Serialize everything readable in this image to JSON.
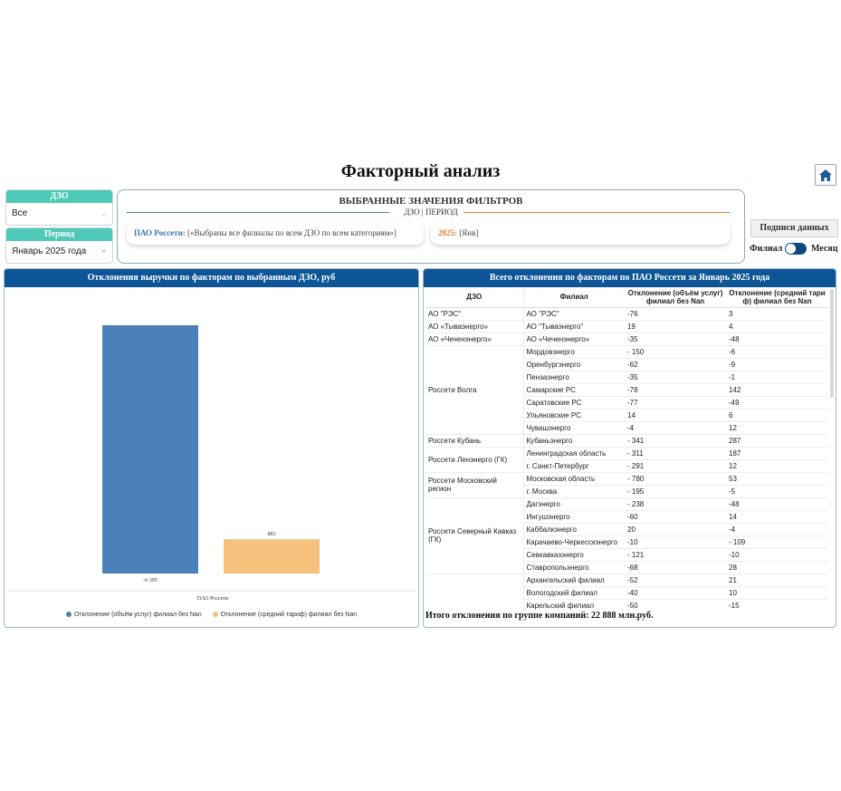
{
  "page": {
    "title": "Факторный анализ"
  },
  "icons": {
    "home": "home-icon"
  },
  "filters": {
    "dzo": {
      "label": "ДЗО",
      "value": "Все"
    },
    "period": {
      "label": "Период",
      "value": "Январь 2025 года"
    }
  },
  "selected": {
    "title": "ВЫБРАННЫЕ ЗНАЧЕНИЯ ФИЛЬТРОВ",
    "subtitle": "ДЗО | ПЕРИОД",
    "dzo_label": "ПАО Россети:",
    "dzo_value": "[«Выбраны все филиалы по всем ДЗО по всем категориям»]",
    "period_label": "2025:",
    "period_value": "[Янв]"
  },
  "controls": {
    "data_labels_button": "Подписи данных",
    "toggle_left": "Филиал",
    "toggle_right": "Месяц"
  },
  "colors": {
    "header_blue": "#0d5596",
    "filter_teal": "#4fc9b7",
    "series1": "#4c80b9",
    "series2": "#f5c17d"
  },
  "left_panel": {
    "title": "Отклонения выручки по факторам по выбранным ДЗО, руб"
  },
  "chart_data": {
    "type": "bar",
    "categories": [
      "ПАО Россети"
    ],
    "series": [
      {
        "name": "Отклонение (объём услуг) филиал без Nan",
        "values": [
          -6395
        ],
        "data_label": "-6 395"
      },
      {
        "name": "Отклонение (средний тариф) филиал без Nan",
        "values": [
          883
        ],
        "data_label": "883"
      }
    ],
    "xlabel": "ПАО Россети",
    "legend": "bottom",
    "grid": false
  },
  "right_panel": {
    "title": "Всего отклонения по факторам по ПАО Россети за Январь 2025 года",
    "columns": [
      "ДЗО",
      "Филиал",
      "Отклонение (объём услуг) филиал без Nan",
      "Отклонение (средний тари ф) филиал без Nan"
    ],
    "groups": [
      {
        "dzo": "АО \"РЭС\"",
        "rows": [
          [
            "АО \"РЭС\"",
            "-76",
            "3"
          ]
        ]
      },
      {
        "dzo": "АО «Тываэнерго»",
        "rows": [
          [
            "АО \"Тываэнерго\"",
            "19",
            "4"
          ]
        ]
      },
      {
        "dzo": "АО «Чеченэнерго»",
        "rows": [
          [
            "АО «Чеченэнерго»",
            "-35",
            "-48"
          ]
        ]
      },
      {
        "dzo": "Россети Волга",
        "rows": [
          [
            "Мордовэнерго",
            "- 150",
            "-6"
          ],
          [
            "Оренбургэнерго",
            "-62",
            "-9"
          ],
          [
            "Пензаэнерго",
            "-35",
            "-1"
          ],
          [
            "Самарские РС",
            "-78",
            "142"
          ],
          [
            "Саратовские РС",
            "-77",
            "-49"
          ],
          [
            "Ульяновские РС",
            "14",
            "6"
          ],
          [
            "Чувашэнерго",
            "-4",
            "12"
          ]
        ]
      },
      {
        "dzo": "Россети Кубань",
        "rows": [
          [
            "Кубаньэнерго",
            "- 341",
            "287"
          ]
        ]
      },
      {
        "dzo": "Россети Ленэнерго (ГК)",
        "rows": [
          [
            "Ленинградская область",
            "- 311",
            "187"
          ],
          [
            "г. Санкт-Петербург",
            "- 291",
            "12"
          ]
        ]
      },
      {
        "dzo": "Россети Московский регион",
        "rows": [
          [
            "Московская область",
            "- 780",
            "53"
          ],
          [
            "г. Москва",
            "- 195",
            "-5"
          ]
        ]
      },
      {
        "dzo": "Россети Северный Кавказ (ГК)",
        "rows": [
          [
            "Дагэнерго",
            "- 238",
            "-48"
          ],
          [
            "Ингушэнерго",
            "-60",
            "14"
          ],
          [
            "Каббалкэнерго",
            "20",
            "-4"
          ],
          [
            "Карачаево-Черкесскэнерго",
            "-10",
            "- 109"
          ],
          [
            "Севкавказэнерго",
            "- 121",
            "-10"
          ],
          [
            "Ставропольэнерго",
            "-68",
            "28"
          ]
        ]
      },
      {
        "dzo": "",
        "rows": [
          [
            "Архангельский филиал",
            "-52",
            "21"
          ],
          [
            "Вологодский филиал",
            "-40",
            "10"
          ],
          [
            "Карельский филиал",
            "-50",
            "-15"
          ]
        ]
      }
    ],
    "total": "Итого отклонения по группе компаний: 22 888 млн.руб."
  }
}
